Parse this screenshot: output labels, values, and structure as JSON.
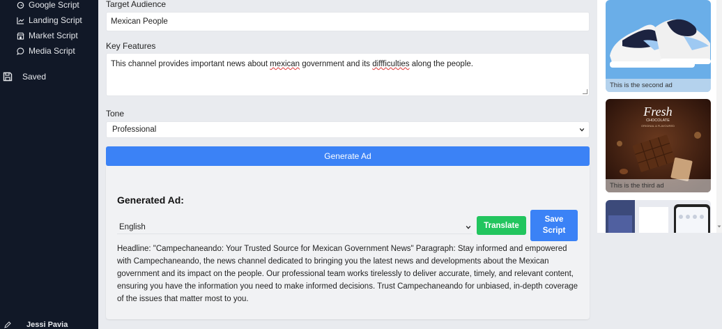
{
  "sidebar": {
    "items": [
      {
        "label": "Google Script",
        "icon": "google-icon"
      },
      {
        "label": "Landing Script",
        "icon": "chart-icon"
      },
      {
        "label": "Market Script",
        "icon": "store-icon"
      },
      {
        "label": "Media Script",
        "icon": "chat-icon"
      }
    ],
    "saved_label": "Saved",
    "user_name": "Jessi Pavia"
  },
  "form": {
    "target_audience_label": "Target Audience",
    "target_audience_value": "Mexican People",
    "key_features_label": "Key Features",
    "key_features_value": {
      "part1": "This channel provides important news about ",
      "word1": "mexican",
      "part2": " government and its ",
      "word2": "diffficulties",
      "part3": " along the people."
    },
    "tone_label": "Tone",
    "tone_value": "Professional",
    "generate_button": "Generate Ad"
  },
  "generated": {
    "title": "Generated Ad:",
    "language": "English",
    "translate_button": "Translate",
    "save_button": "Save Script",
    "text": "Headline: \"Campechaneando: Your Trusted Source for Mexican Government News\" Paragraph: Stay informed and empowered with Campechaneando, the news channel dedicated to bringing you the latest news and developments about the Mexican government and its impact on the people. Our professional team works tirelessly to deliver accurate, timely, and relevant content, ensuring you have the information you need to make informed decisions. Trust Campechaneando for unbiased, in-depth coverage of the issues that matter most to you."
  },
  "gallery": {
    "captions": [
      "This is the second ad",
      "This is the third ad"
    ],
    "chocolate_brand": "Fresh",
    "chocolate_sub": "CHOCOLATE",
    "chocolate_tag": "ORIGINAL & FLAVOURED"
  },
  "colors": {
    "sidebar_bg": "#111827",
    "primary": "#3b82f6",
    "success": "#22c55e"
  }
}
